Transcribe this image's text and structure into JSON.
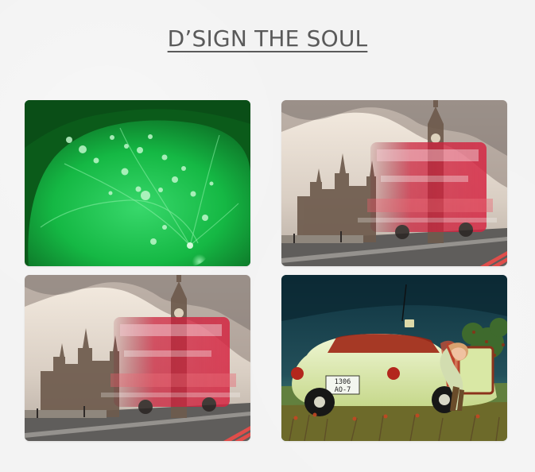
{
  "page": {
    "title": "D’SIGN THE SOUL"
  },
  "gallery": {
    "items": [
      {
        "image": "green-leaf-with-water-drops"
      },
      {
        "image": "big-ben-with-red-bus"
      },
      {
        "image": "big-ben-with-red-bus"
      },
      {
        "image": "vintage-car-with-woman"
      }
    ]
  },
  "colors": {
    "background": "#f3f3f3",
    "title": "#5a5a5a",
    "leaf_green": "#10b63c",
    "bus_red": "#d41f3a",
    "sky_cream": "#f2e7da",
    "car_cream": "#e9f2c6"
  },
  "plate": {
    "text_line1": "1306",
    "text_line2": "AO-7"
  }
}
